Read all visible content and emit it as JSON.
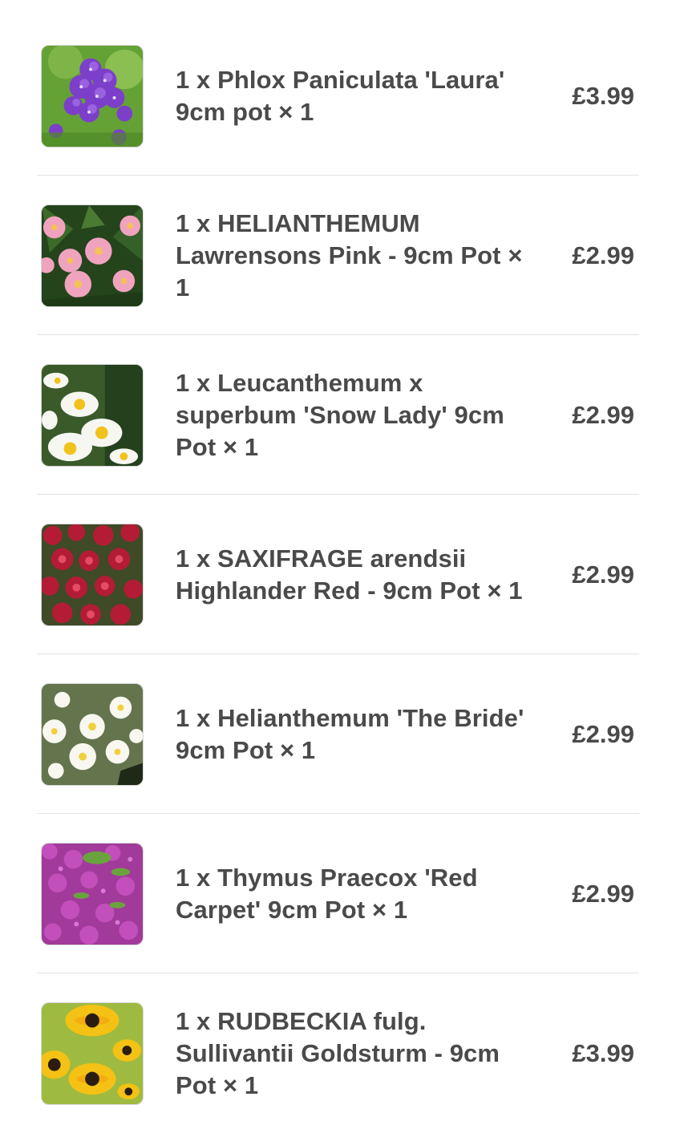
{
  "items": [
    {
      "title": "1 x Phlox Paniculata 'Laura' 9cm pot × 1",
      "price": "£3.99",
      "image_icon": "phlox-photo"
    },
    {
      "title": "1 x HELIANTHEMUM Lawrensons Pink - 9cm Pot × 1",
      "price": "£2.99",
      "image_icon": "helianthemum-pink-photo"
    },
    {
      "title": "1 x Leucanthemum x superbum 'Snow Lady' 9cm Pot × 1",
      "price": "£2.99",
      "image_icon": "leucanthemum-photo"
    },
    {
      "title": "1 x SAXIFRAGE arendsii Highlander Red - 9cm Pot × 1",
      "price": "£2.99",
      "image_icon": "saxifrage-red-photo"
    },
    {
      "title": "1 x Helianthemum 'The Bride' 9cm Pot × 1",
      "price": "£2.99",
      "image_icon": "helianthemum-bride-photo"
    },
    {
      "title": "1 x Thymus Praecox 'Red Carpet' 9cm Pot × 1",
      "price": "£2.99",
      "image_icon": "thymus-photo"
    },
    {
      "title": "1 x RUDBECKIA fulg. Sullivantii Goldsturm - 9cm Pot × 1",
      "price": "£3.99",
      "image_icon": "rudbeckia-photo"
    }
  ],
  "colors": {
    "text": "#4a4a4a",
    "divider": "#e2e2e2",
    "background": "#ffffff"
  }
}
